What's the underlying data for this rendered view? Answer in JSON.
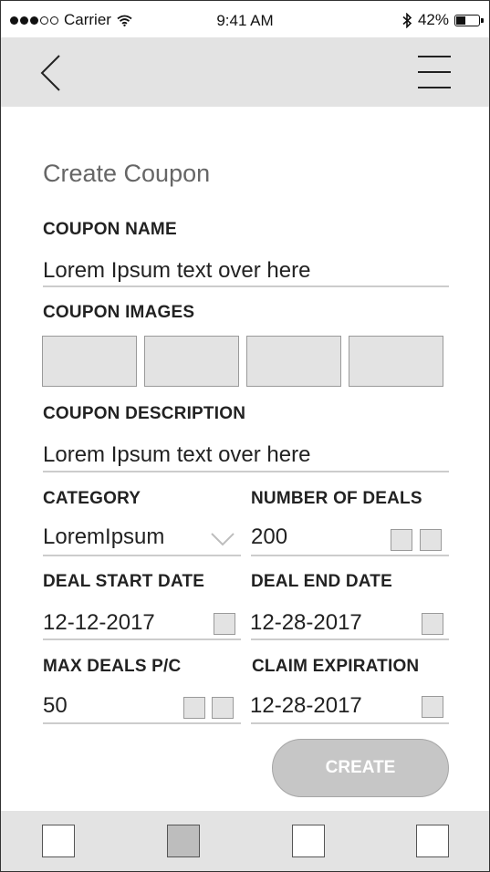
{
  "status_bar": {
    "carrier": "Carrier",
    "time": "9:41 AM",
    "battery": "42%"
  },
  "navbar": {
    "back_icon": "chevron-left-icon",
    "menu_icon": "hamburger-menu-icon"
  },
  "form": {
    "title": "Create Coupon",
    "coupon_name": {
      "label": "COUPON NAME",
      "value": "Lorem Ipsum text over here"
    },
    "coupon_images": {
      "label": "COUPON IMAGES",
      "slot_count": 4
    },
    "coupon_description": {
      "label": "COUPON DESCRIPTION",
      "value": "Lorem Ipsum text over here"
    },
    "category": {
      "label": "CATEGORY",
      "value": "LoremIpsum"
    },
    "number_of_deals": {
      "label": "NUMBER OF DEALS",
      "value": "200"
    },
    "deal_start_date": {
      "label": "DEAL START DATE",
      "value": "12-12-2017"
    },
    "deal_end_date": {
      "label": "DEAL END DATE",
      "value": "12-28-2017"
    },
    "max_deals_pc": {
      "label": "MAX DEALS P/C",
      "value": "50"
    },
    "claim_expiration": {
      "label": "CLAIM EXPIRATION",
      "value": "12-28-2017"
    },
    "create_label": "CREATE"
  },
  "tab_bar": {
    "active_index": 1,
    "tab_count": 4
  }
}
